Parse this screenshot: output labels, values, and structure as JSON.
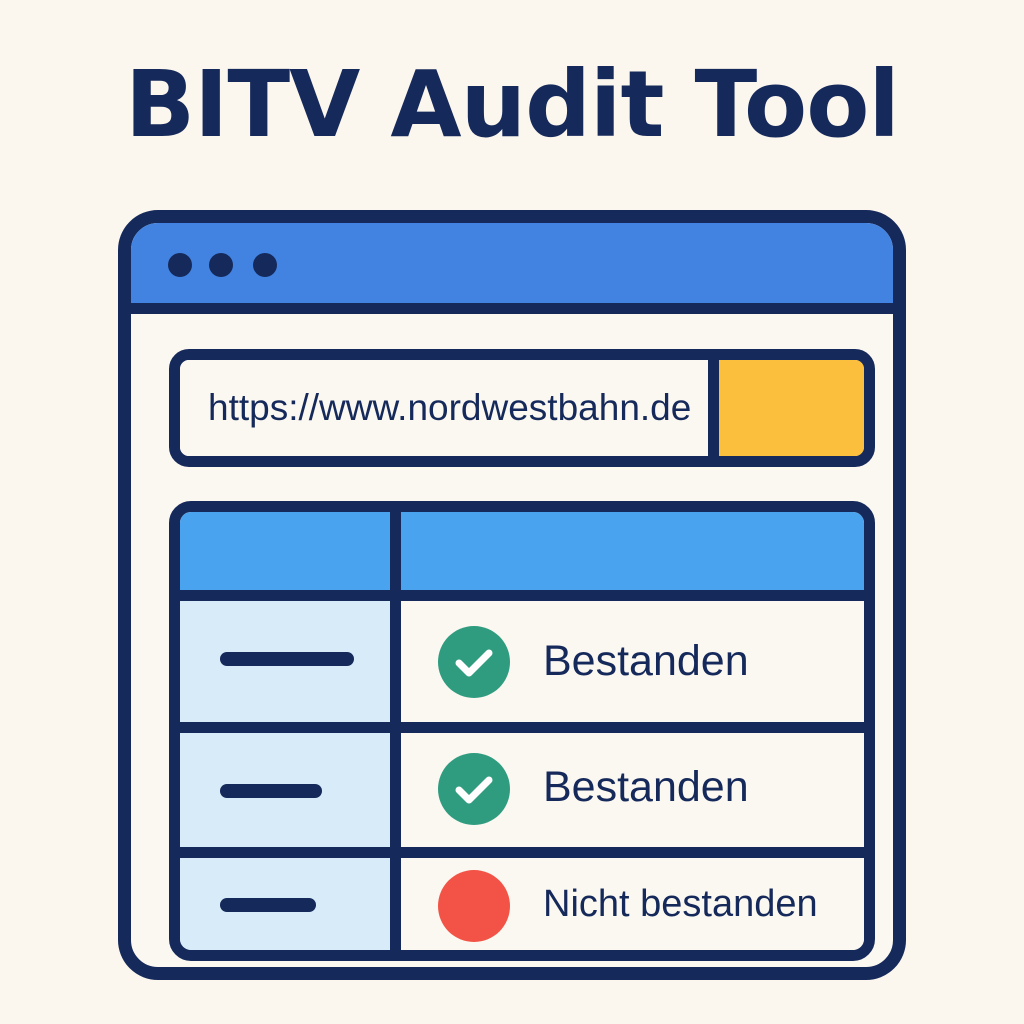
{
  "app": {
    "title": "BITV Audit Tool"
  },
  "url_bar": {
    "value": "https://www.nordwestbahn.de",
    "go_button_color": "#fbbf3d"
  },
  "results": {
    "rows": [
      {
        "status": "pass",
        "label": "Bestanden",
        "icon": "check-icon"
      },
      {
        "status": "pass",
        "label": "Bestanden",
        "icon": "check-icon"
      },
      {
        "status": "fail",
        "label": "Nicht bestanden",
        "icon": "fail-dot-icon"
      }
    ]
  },
  "colors": {
    "background": "#fbf6ee",
    "outline": "#15295a",
    "titlebar": "#4283e1",
    "table_header": "#4aa3ee",
    "row_left": "#d8ebf8",
    "pass": "#2f9c80",
    "fail": "#f25346"
  }
}
